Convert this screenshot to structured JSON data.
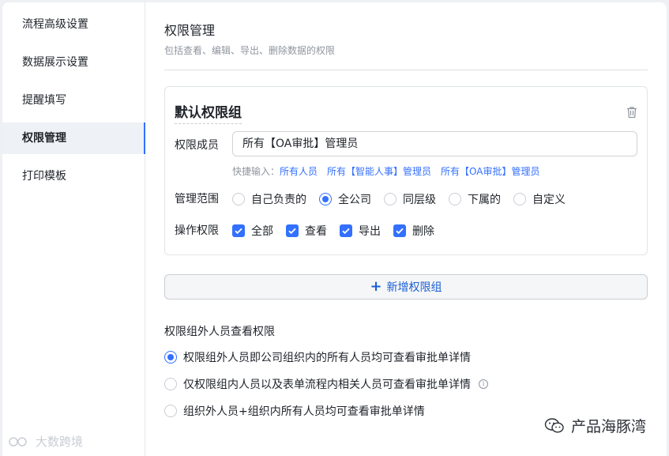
{
  "sidebar": {
    "items": [
      {
        "label": "流程高级设置"
      },
      {
        "label": "数据展示设置"
      },
      {
        "label": "提醒填写"
      },
      {
        "label": "权限管理"
      },
      {
        "label": "打印模板"
      }
    ],
    "active_index": 3
  },
  "header": {
    "title": "权限管理",
    "subtitle": "包括查看、编辑、导出、删除数据的权限"
  },
  "group": {
    "name": "默认权限组",
    "members_label": "权限成员",
    "members_value": "所有【OA审批】管理员",
    "quick_label": "快捷输入：",
    "quick_links": [
      "所有人员",
      "所有【智能人事】管理员",
      "所有【OA审批】管理员"
    ],
    "scope_label": "管理范围",
    "scope_options": [
      "自己负责的",
      "全公司",
      "同层级",
      "下属的",
      "自定义"
    ],
    "scope_selected": "全公司",
    "ops_label": "操作权限",
    "ops_options": [
      "全部",
      "查看",
      "导出",
      "删除"
    ],
    "ops_checked": [
      "全部",
      "查看",
      "导出",
      "删除"
    ]
  },
  "add_group_label": "新增权限组",
  "outside": {
    "title": "权限组外人员查看权限",
    "options": [
      "权限组外人员即公司组织内的所有人员均可查看审批单详情",
      "仅权限组内人员以及表单流程内相关人员可查看审批单详情",
      "组织外人员+组织内所有人员均可查看审批单详情"
    ],
    "selected_index": 0,
    "info_glyph": "i"
  },
  "watermarks": {
    "right": "产品海豚湾",
    "left": "大数跨境"
  },
  "colors": {
    "accent": "#3370ff",
    "link": "#3370ff",
    "muted": "#8f959e"
  }
}
